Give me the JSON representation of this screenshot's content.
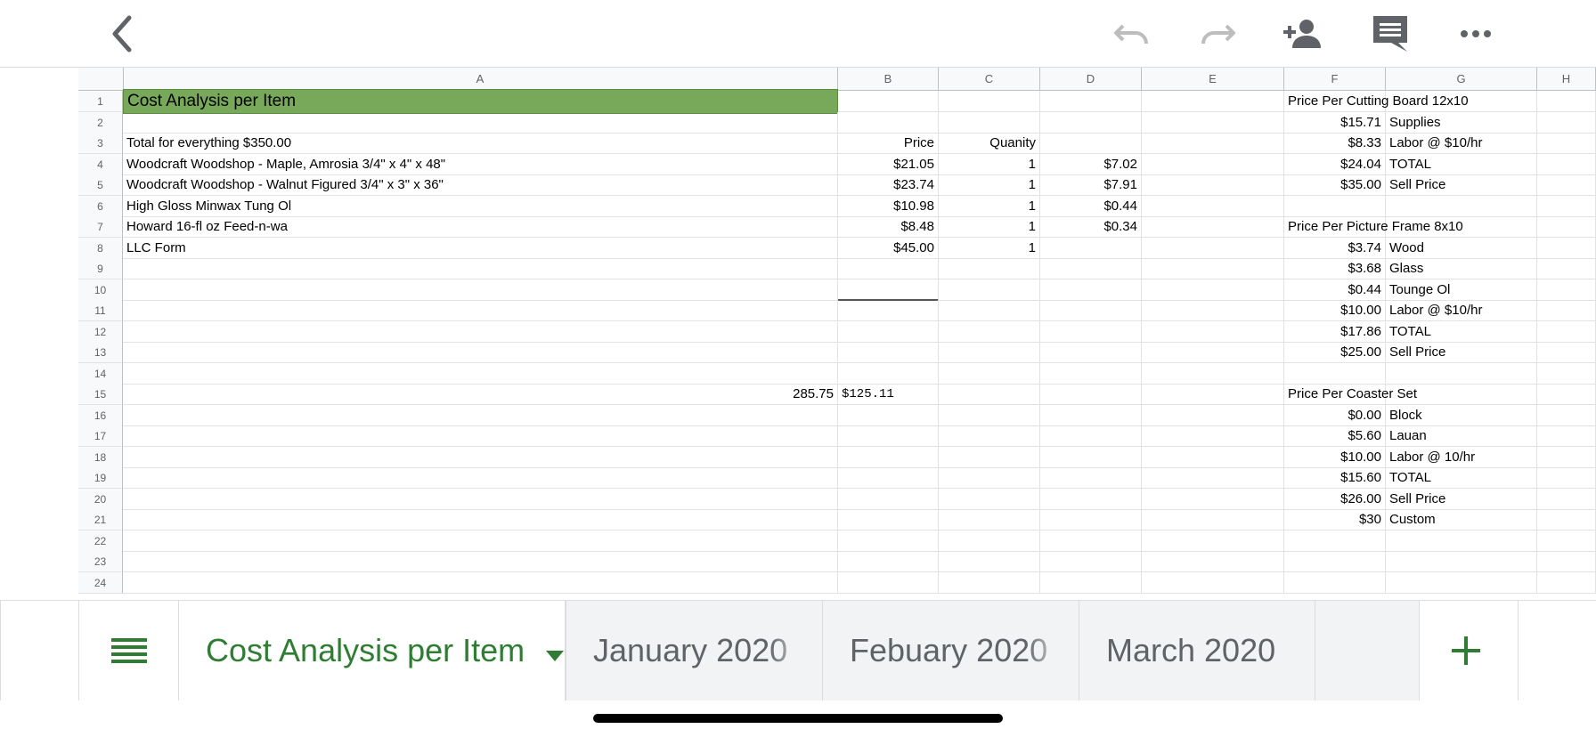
{
  "toolbar": {
    "back_icon": "back-chevron-icon",
    "undo_icon": "undo-icon",
    "redo_icon": "redo-icon",
    "share_icon": "add-person-icon",
    "comment_icon": "comment-icon",
    "more_icon": "more-horiz-icon"
  },
  "columns": [
    "A",
    "B",
    "C",
    "D",
    "E",
    "F",
    "G",
    "H"
  ],
  "row_numbers": [
    "1",
    "2",
    "3",
    "4",
    "5",
    "6",
    "7",
    "8",
    "9",
    "10",
    "11",
    "12",
    "13",
    "14",
    "15",
    "16",
    "17",
    "18",
    "19",
    "20",
    "21",
    "22",
    "23",
    "24"
  ],
  "rows": [
    {
      "A": "Cost Analysis per Item",
      "F": "Price Per Cutting Board 12x10"
    },
    {
      "F": "$15.71",
      "G": "Supplies"
    },
    {
      "A": "Total for everything $350.00",
      "B": "Price",
      "C": "Quanity",
      "F": "$8.33",
      "G": "Labor @ $10/hr"
    },
    {
      "A": "Woodcraft Woodshop - Maple, Amrosia 3/4\" x 4\" x 48\"",
      "B": "$21.05",
      "C": "1",
      "D": "$7.02",
      "F": "$24.04",
      "G": "TOTAL"
    },
    {
      "A": "Woodcraft Woodshop - Walnut Figured 3/4\" x 3\" x 36\"",
      "B": "$23.74",
      "C": "1",
      "D": "$7.91",
      "F": "$35.00",
      "G": "Sell Price"
    },
    {
      "A": "High Gloss Minwax Tung Ol",
      "B": "$10.98",
      "C": "1",
      "D": "$0.44"
    },
    {
      "A": "Howard 16-fl oz Feed-n-wa",
      "B": "$8.48",
      "C": "1",
      "D": "$0.34",
      "F": "Price Per Picture Frame 8x10"
    },
    {
      "A": "LLC Form",
      "B": "$45.00",
      "C": "1",
      "F": "$3.74",
      "G": "Wood"
    },
    {
      "F": "$3.68",
      "G": "Glass"
    },
    {
      "F": "$0.44",
      "G": "Tounge Ol"
    },
    {
      "F": "$10.00",
      "G": "Labor @ $10/hr"
    },
    {
      "F": "$17.86",
      "G": "TOTAL"
    },
    {
      "F": "$25.00",
      "G": "Sell Price"
    },
    {},
    {
      "A": "285.75",
      "B": "$125.11",
      "F": "Price Per Coaster Set"
    },
    {
      "F": "$0.00",
      "G": "Block"
    },
    {
      "F": "$5.60",
      "G": "Lauan"
    },
    {
      "F": "$10.00",
      "G": "Labor @ 10/hr"
    },
    {
      "F": "$15.60",
      "G": "TOTAL"
    },
    {
      "F": "$26.00",
      "G": "Sell Price"
    },
    {
      "F": "$30",
      "G": "Custom"
    },
    {},
    {},
    {}
  ],
  "sheet_tabs": {
    "menu_icon": "sheets-list-icon",
    "active": "Cost Analysis per Item",
    "dropdown_icon": "caret-down-icon",
    "tabs": [
      "January 2020",
      "Febuary 2020",
      "March 2020"
    ],
    "add_icon": "add-sheet-icon"
  },
  "colors": {
    "title_fill": "#78a95a",
    "active_tab": "#2e7d32",
    "header_bg": "#f8f9fa"
  }
}
